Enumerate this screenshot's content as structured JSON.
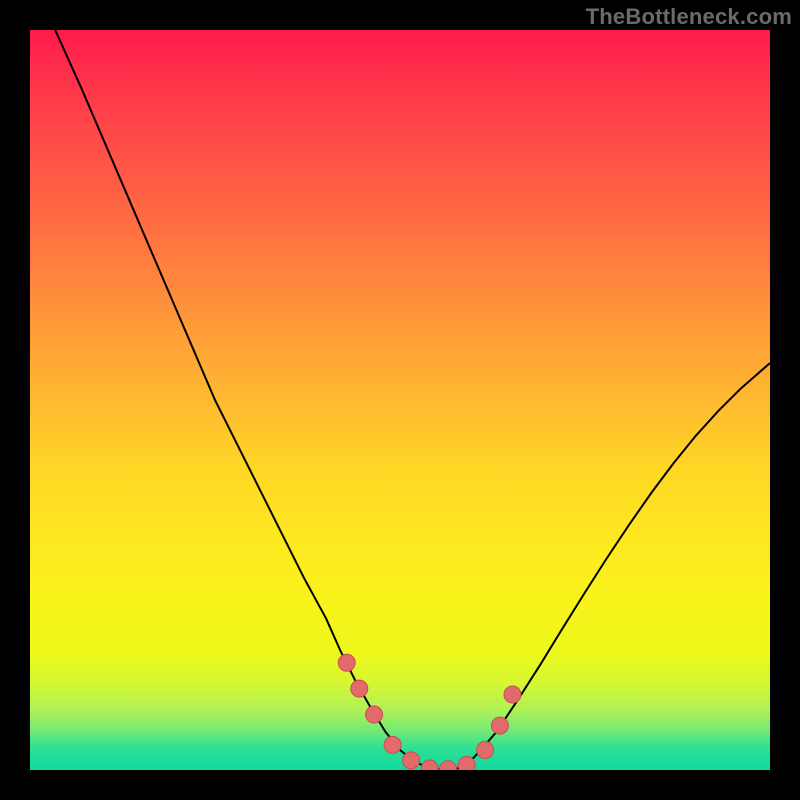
{
  "watermark": "TheBottleneck.com",
  "chart_data": {
    "type": "line",
    "title": "",
    "xlabel": "",
    "ylabel": "",
    "xlim": [
      0,
      100
    ],
    "ylim": [
      0,
      100
    ],
    "grid": false,
    "series": [
      {
        "name": "curve",
        "x": [
          0,
          3.4,
          7,
          10,
          13,
          16,
          19,
          22,
          25,
          28,
          31,
          34,
          37,
          40,
          42,
          44,
          46,
          48,
          50,
          52,
          54,
          56,
          58,
          60,
          63,
          66,
          69,
          72,
          75,
          78,
          81,
          84,
          87,
          90,
          93,
          96,
          100
        ],
        "values": [
          110,
          100,
          92,
          85,
          78,
          71,
          64,
          57,
          50,
          44,
          38,
          32,
          26,
          20.5,
          16,
          12,
          8.5,
          5.2,
          2.7,
          1.1,
          0.25,
          0,
          0.25,
          1.7,
          5.1,
          9.6,
          14.3,
          19.2,
          24,
          28.7,
          33.2,
          37.5,
          41.5,
          45.2,
          48.5,
          51.5,
          55
        ]
      },
      {
        "name": "markers",
        "x": [
          42.8,
          44.5,
          46.5,
          49.0,
          51.5,
          54.0,
          56.5,
          59.0,
          61.5,
          63.5,
          65.2
        ],
        "values": [
          14.5,
          11.0,
          7.5,
          3.4,
          1.3,
          0.2,
          0.1,
          0.7,
          2.7,
          6.0,
          10.2
        ]
      }
    ],
    "colors": {
      "curve": "#000000",
      "marker_fill": "#e26a6a",
      "marker_stroke": "#c74f4f",
      "background_top": "#ff1a4a",
      "background_bottom": "#11d9a2"
    }
  }
}
